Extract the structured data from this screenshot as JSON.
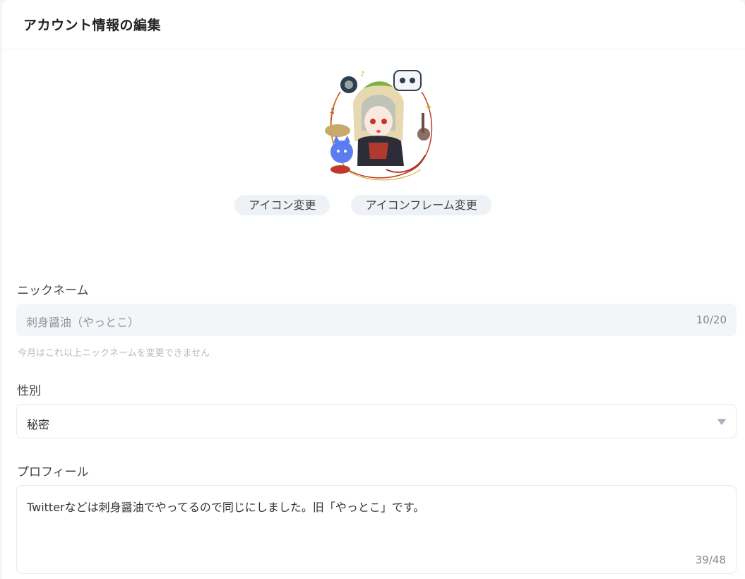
{
  "header": {
    "title": "アカウント情報の編集"
  },
  "avatar": {
    "icon": "character-avatar-with-musical-frame"
  },
  "buttons": {
    "change_icon": "アイコン変更",
    "change_frame": "アイコンフレーム変更"
  },
  "nickname": {
    "label": "ニックネーム",
    "value": "刺身醤油（やっとこ）",
    "counter": "10/20",
    "hint": "今月はこれ以上ニックネームを変更できません"
  },
  "gender": {
    "label": "性別",
    "value": "秘密",
    "caret_icon": "caret-down-icon"
  },
  "profile": {
    "label": "プロフィール",
    "value": "Twitterなどは刺身醤油でやってるので同じにしました。旧「やっとこ」です。",
    "counter": "39/48"
  },
  "colors": {
    "accent": "#eef1f6",
    "input_bg": "#f3f5f9",
    "border": "#e8eaef",
    "caret": "#aab1c0"
  }
}
